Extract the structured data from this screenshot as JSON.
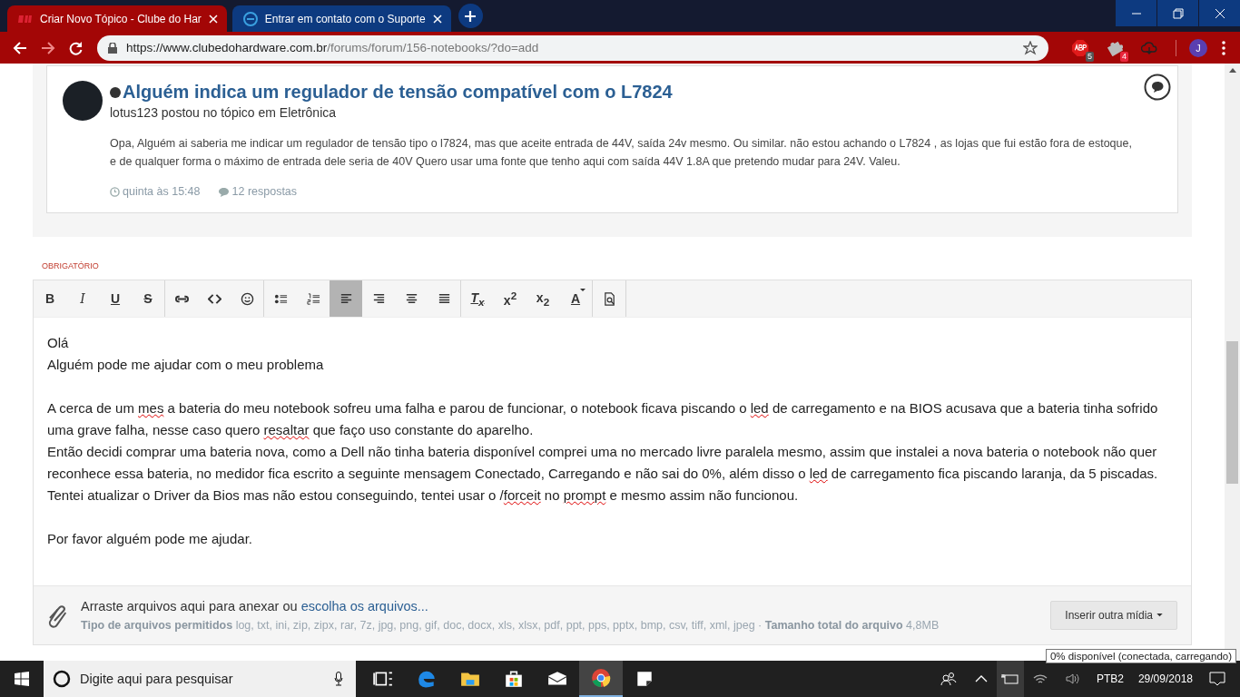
{
  "browser": {
    "tabs": [
      {
        "title": "Criar Novo Tópico - Clube do Har",
        "selected": true,
        "kind": "cdh"
      },
      {
        "title": "Entrar em contato com o Suporte",
        "selected": false,
        "kind": "dell"
      }
    ],
    "url_host": "https://www.clubedohardware.com.br",
    "url_path": "/forums/forum/156-notebooks/?do=add",
    "forward_disabled": true,
    "extensions": [
      {
        "kind": "abp",
        "badge": "5"
      },
      {
        "kind": "puzzle",
        "badge": "4"
      },
      {
        "kind": "cloud"
      }
    ],
    "avatar": "J"
  },
  "post": {
    "title": "Alguém indica um regulador de tensão compatível com o L7824",
    "subtitle": "lotus123 postou no tópico em Eletrônica",
    "body": "Opa, Alguém ai saberia me indicar um regulador de tensão tipo o l7824, mas que aceite entrada de 44V, saída 24v mesmo. Ou similar. não estou achando o L7824 , as lojas que fui estão fora de estoque, e de qualquer forma o máximo de entrada dele seria de 40V Quero usar uma fonte que tenho aqui com saída 44V 1.8A que pretendo mudar para 24V. Valeu.",
    "time": "quinta às 15:48",
    "replies": "12 respostas"
  },
  "required_label": "OBRIGATÓRIO",
  "toolbar": [
    [
      {
        "kind": "text",
        "label": "B",
        "selected": false
      },
      {
        "kind": "text",
        "label": "I",
        "selected": false
      },
      {
        "kind": "text",
        "label": "U",
        "selected": false
      },
      {
        "kind": "text",
        "label": "S",
        "selected": false
      }
    ],
    [
      {
        "kind": "link",
        "selected": false
      },
      {
        "kind": "code",
        "selected": false
      },
      {
        "kind": "emoji",
        "selected": false
      }
    ],
    [
      {
        "kind": "bulleted-list",
        "selected": false
      },
      {
        "kind": "numbered-list",
        "selected": false
      },
      {
        "kind": "align-left",
        "selected": true
      },
      {
        "kind": "align-right",
        "selected": false
      },
      {
        "kind": "align-center",
        "selected": false
      },
      {
        "kind": "align-justify",
        "selected": false
      }
    ],
    [
      {
        "kind": "text",
        "label": "T$_{x}$",
        "selected": false
      },
      {
        "kind": "text",
        "label": "x$^{2}$",
        "selected": false
      },
      {
        "kind": "text",
        "label": "x$_{2}$",
        "selected": false
      },
      {
        "kind": "color",
        "label": "A",
        "selected": false
      }
    ],
    [
      {
        "kind": "preview",
        "selected": false
      }
    ]
  ],
  "editor": {
    "paragraphs": [
      {
        "lines": [
          [
            {
              "text": "Olá",
              "misspelled": false
            }
          ],
          [
            {
              "text": "Alguém pode me ajudar com o meu problema",
              "misspelled": false
            }
          ]
        ]
      },
      {
        "lines": [
          [
            {
              "text": "A cerca de um ",
              "misspelled": false
            },
            {
              "text": "mes",
              "misspelled": true
            },
            {
              "text": " a bateria do meu notebook sofreu uma falha e parou de funcionar, o notebook ficava piscando o ",
              "misspelled": false
            },
            {
              "text": "led",
              "misspelled": true
            },
            {
              "text": " de carregamento e na BIOS acusava que a bateria tinha sofrido uma grave falha, nesse caso quero ",
              "misspelled": false
            },
            {
              "text": "resaltar",
              "misspelled": true
            },
            {
              "text": " que faço uso constante do aparelho.",
              "misspelled": false
            }
          ],
          [
            {
              "text": "Então decidi comprar uma bateria nova, como a Dell não tinha bateria disponível comprei uma no mercado livre paralela mesmo, assim que instalei a nova bateria o notebook não quer reconhece essa bateria, no medidor fica escrito a seguinte mensagem Conectado, Carregando e não sai do 0%, além disso o ",
              "misspelled": false
            },
            {
              "text": "led",
              "misspelled": true
            },
            {
              "text": " de carregamento fica piscando laranja, da 5 piscadas.",
              "misspelled": false
            }
          ],
          [
            {
              "text": "Tentei atualizar o Driver da Bios mas não estou conseguindo, tentei usar o /",
              "misspelled": false
            },
            {
              "text": "forceit",
              "misspelled": true
            },
            {
              "text": " no ",
              "misspelled": false
            },
            {
              "text": "prompt",
              "misspelled": true
            },
            {
              "text": " e mesmo assim não funcionou.",
              "misspelled": false
            }
          ]
        ]
      },
      {
        "lines": [
          [
            {
              "text": "Por favor alguém pode me ajudar.",
              "misspelled": false
            }
          ]
        ]
      }
    ]
  },
  "attachments": {
    "prompt": "Arraste arquivos aqui para anexar ou",
    "link": "escolha os arquivos...",
    "types_line": "**Tipo de arquivos permitidos** log, txt, ini, zip, zipx, rar, 7z, jpg, png, gif, doc, docx, xls, xlsx, pdf, ppt, pps, pptx, bmp, csv, tiff, xml, jpeg · **Tamanho total do arquivo** 4,8MB",
    "button": "Inserir outra mídia"
  },
  "taskbar": {
    "search_placeholder": "Digite aqui para pesquisar",
    "apps": [
      {
        "kind": "task-view",
        "selected": false
      },
      {
        "kind": "edge",
        "selected": false
      },
      {
        "kind": "explorer",
        "selected": false
      },
      {
        "kind": "store",
        "selected": false
      },
      {
        "kind": "mail",
        "selected": false
      },
      {
        "kind": "chrome",
        "selected": true
      },
      {
        "kind": "notes",
        "selected": false
      }
    ],
    "language": "PTB2",
    "date": "29/09/2018",
    "tooltip": "0% disponível (conectada, carregando)"
  }
}
